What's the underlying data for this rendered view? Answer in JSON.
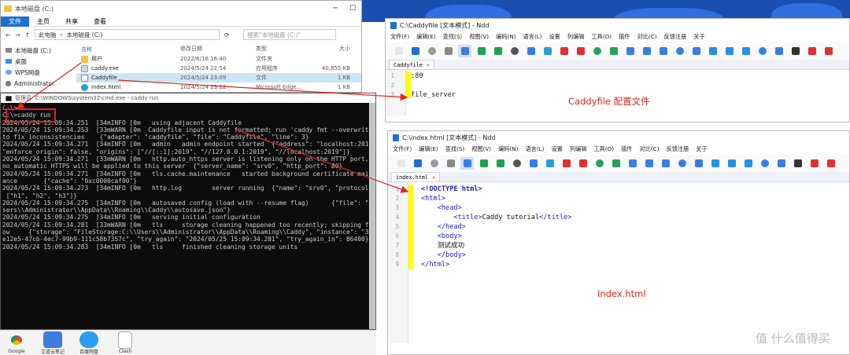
{
  "explorer": {
    "title": "本地磁盘 (C:)",
    "ribbon": [
      "文件",
      "主页",
      "共享",
      "查看"
    ],
    "breadcrumb": [
      "此电脑",
      "本地磁盘 (C:)"
    ],
    "search_placeholder": "搜索\"本地磁盘 (C:)\"",
    "nav": [
      "本地磁盘 (C:)",
      "桌面",
      "WPS网盘",
      "Administrator"
    ],
    "headers": {
      "name": "名称",
      "date": "修改日期",
      "type": "类型",
      "size": "大小"
    },
    "files": [
      {
        "name": "用户",
        "date": "2022/6/16 16:40",
        "type": "文件夹",
        "size": ""
      },
      {
        "name": "caddy.exe",
        "date": "2024/5/24 22:54",
        "type": "应用程序",
        "size": "40,855 KB"
      },
      {
        "name": "Caddyfile",
        "date": "2024/5/24 23:09",
        "type": "文件",
        "size": "1 KB"
      },
      {
        "name": "index.html",
        "date": "2024/5/24 23:12",
        "type": "Microsoft Edge...",
        "size": "1 KB"
      }
    ]
  },
  "cmd": {
    "title": "管理员: C:\\WINDOWS\\system32\\cmd.exe - caddy  run",
    "lines": [
      "C:\\>",
      "C:\\>caddy run",
      "2024/05/24 15:09:34.251  [34mINFO [0m   using adjacent Caddyfile",
      "2024/05/24 15:09:34.253  [33mWARN [0m  Caddyfile input is not formatted; run 'caddy fmt --overwrite'",
      "to fix inconsistencies    {\"adapter\": \"caddyfile\", \"file\": \"Caddyfile\", \"line\": 3}",
      "2024/05/24 15:09:34.271  [34mINFO [0m   admin   admin endpoint started  {\"address\": \"localhost:2019\",",
      "\"enforce_origin\": false, \"origins\": [\"//[::1]:2019\", \"//127.0.0.1:2019\", \"//localhost:2019\"]}",
      "2024/05/24 15:09:34.271  [33mWARN [0m   http.auto_https server is listening only on the HTTP port, so",
      "no automatic HTTPS will be applied to this server  {\"server_name\": \"srv0\", \"http_port\": 80}",
      "2024/05/24 15:09:34.271  [34mINFO [0m   tls.cache.maintenance   started background certificate mainten",
      "ance       {\"cache\": \"0xc0000caf00\"}",
      "2024/05/24 15:09:34.273  [34mINFO [0m   http.log        server running  {\"name\": \"srv0\", \"protocols\":",
      " [\"h1\", \"h2\", \"h3\"]}",
      "2024/05/24 15:09:34.275  [34mINFO [0m   autosaved config (load with --resume flag)      {\"file\": \"C:\\\\U",
      "sers\\\\Administrator\\\\AppData\\\\Roaming\\\\Caddy\\\\autosave.json\"}",
      "2024/05/24 15:09:34.275  [34mINFO [0m   serving initial configuration",
      "2024/05/24 15:09:34.281  [33mWARN [0m   tls     storage cleaning happened too recently; skipping for n",
      "ow     {\"storage\": \"FileStorage:C:\\\\Users\\\\Administrator\\\\AppData\\\\Roaming\\\\Caddy\", \"instance\": \"3d",
      "e12e5-47cb-4ec7-99b9-111c58b7357c\", \"try_again\": \"2024/05/25 15:09:34.281\", \"try_again_in\": 86400}",
      "2024/05/24 15:09:34.283  [34mINFO [0m   tls     finished cleaning storage units"
    ]
  },
  "taskbar": [
    "Google",
    "文道云笔记",
    "百度网盘",
    "Clash"
  ],
  "ndd1": {
    "title": "C:\\Caddyfile [文本模式] - Ndd",
    "menu": [
      "文件(F)",
      "编辑(E)",
      "查找(S)",
      "视图(V)",
      "编码(N)",
      "语言(L)",
      "设置",
      "列编辑",
      "工具(O)",
      "插件",
      "对比(C)",
      "反馈注册",
      "关于"
    ],
    "tab": "Caddyfile",
    "line_numbers": [
      "1",
      "2",
      "3"
    ],
    "lines": [
      ":80",
      "",
      "file_server"
    ]
  },
  "ndd2": {
    "title": "C:\\index.html [文本模式] - Ndd",
    "menu": [
      "文件(F)",
      "编辑(E)",
      "查找(S)",
      "视图(V)",
      "编码(N)",
      "语言(L)",
      "设置",
      "列编辑",
      "工具(O)",
      "插件",
      "对比(C)",
      "反馈注册",
      "关于"
    ],
    "tab": "index.html",
    "line_numbers": [
      "1",
      "2",
      "3",
      "4",
      "5",
      "6",
      "7",
      "8",
      "9"
    ],
    "lines": [
      "<!DOCTYPE html>",
      "<html>",
      "    <head>",
      "        <title>Caddy tutorial</title>",
      "    </head>",
      "    <body>",
      "    测试成功",
      "    </body>",
      "</html>"
    ]
  },
  "annotations": {
    "caddyfile": "Caddyfile 配置文件",
    "index": "Index.html"
  },
  "watermark": "值 什么值得买",
  "colors": {
    "annotation": "#e0261c",
    "highlight": "#ffff00",
    "accent": "#1e6fd0"
  }
}
